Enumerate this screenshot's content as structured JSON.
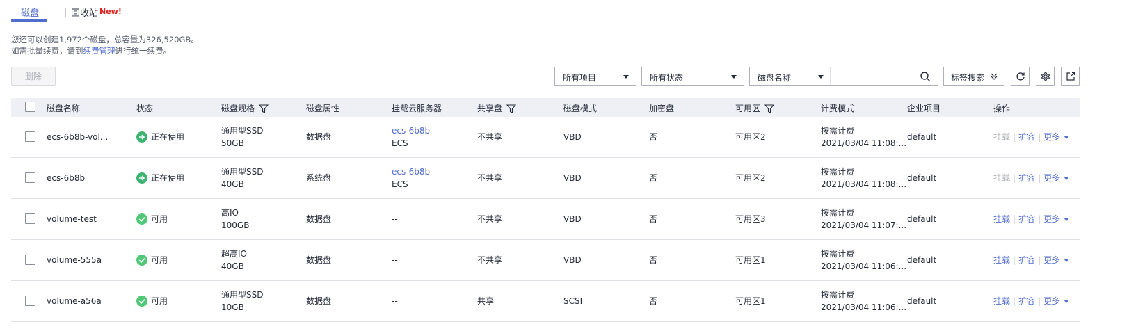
{
  "tabs": {
    "disk": "磁盘",
    "recycle": "回收站",
    "new_badge": "New!"
  },
  "quota": {
    "line1": "您还可以创建1,972个磁盘，总容量为326,520GB。",
    "line2_prefix": "如需批量续费，请到",
    "line2_link": "续费管理",
    "line2_suffix": "进行统一续费。"
  },
  "toolbar": {
    "delete_label": "删除",
    "project_select": "所有项目",
    "status_select": "所有状态",
    "search_field": "磁盘名称",
    "search_value": "",
    "tag_search": "标签搜索"
  },
  "columns": {
    "name": "磁盘名称",
    "status": "状态",
    "spec": "磁盘规格",
    "attr": "磁盘属性",
    "server": "挂载云服务器",
    "shared": "共享盘",
    "mode": "磁盘模式",
    "encrypted": "加密盘",
    "az": "可用区",
    "billing": "计费模式",
    "project": "企业项目",
    "ops": "操作"
  },
  "ops": {
    "attach": "挂载",
    "expand": "扩容",
    "more": "更多"
  },
  "rows": [
    {
      "name": "ecs-6b8b-vol...",
      "status": "正在使用",
      "status_kind": "in-use",
      "spec_type": "通用型SSD",
      "spec_size": "50GB",
      "attr": "数据盘",
      "server_name": "ecs-6b8b",
      "server_type": "ECS",
      "shared": "不共享",
      "mode": "VBD",
      "encrypted": "否",
      "az": "可用区2",
      "billing_mode": "按需计费",
      "billing_time": "2021/03/04 11:08:...",
      "project": "default",
      "attach_enabled": false
    },
    {
      "name": "ecs-6b8b",
      "status": "正在使用",
      "status_kind": "in-use",
      "spec_type": "通用型SSD",
      "spec_size": "40GB",
      "attr": "系统盘",
      "server_name": "ecs-6b8b",
      "server_type": "ECS",
      "shared": "不共享",
      "mode": "VBD",
      "encrypted": "否",
      "az": "可用区2",
      "billing_mode": "按需计费",
      "billing_time": "2021/03/04 11:08:...",
      "project": "default",
      "attach_enabled": false
    },
    {
      "name": "volume-test",
      "status": "可用",
      "status_kind": "available",
      "spec_type": "高IO",
      "spec_size": "100GB",
      "attr": "数据盘",
      "server_name": "--",
      "server_type": "",
      "shared": "不共享",
      "mode": "VBD",
      "encrypted": "否",
      "az": "可用区3",
      "billing_mode": "按需计费",
      "billing_time": "2021/03/04 11:07:...",
      "project": "default",
      "attach_enabled": true
    },
    {
      "name": "volume-555a",
      "status": "可用",
      "status_kind": "available",
      "spec_type": "超高IO",
      "spec_size": "40GB",
      "attr": "数据盘",
      "server_name": "--",
      "server_type": "",
      "shared": "不共享",
      "mode": "VBD",
      "encrypted": "否",
      "az": "可用区1",
      "billing_mode": "按需计费",
      "billing_time": "2021/03/04 11:06:...",
      "project": "default",
      "attach_enabled": true
    },
    {
      "name": "volume-a56a",
      "status": "可用",
      "status_kind": "available",
      "spec_type": "通用型SSD",
      "spec_size": "10GB",
      "attr": "数据盘",
      "server_name": "--",
      "server_type": "",
      "shared": "共享",
      "mode": "SCSI",
      "encrypted": "否",
      "az": "可用区1",
      "billing_mode": "按需计费",
      "billing_time": "2021/03/04 11:06:...",
      "project": "default",
      "attach_enabled": true
    }
  ],
  "colors": {
    "accent": "#526ecc",
    "in_use": "#3cb371",
    "available": "#50c878",
    "danger": "#e02424"
  }
}
